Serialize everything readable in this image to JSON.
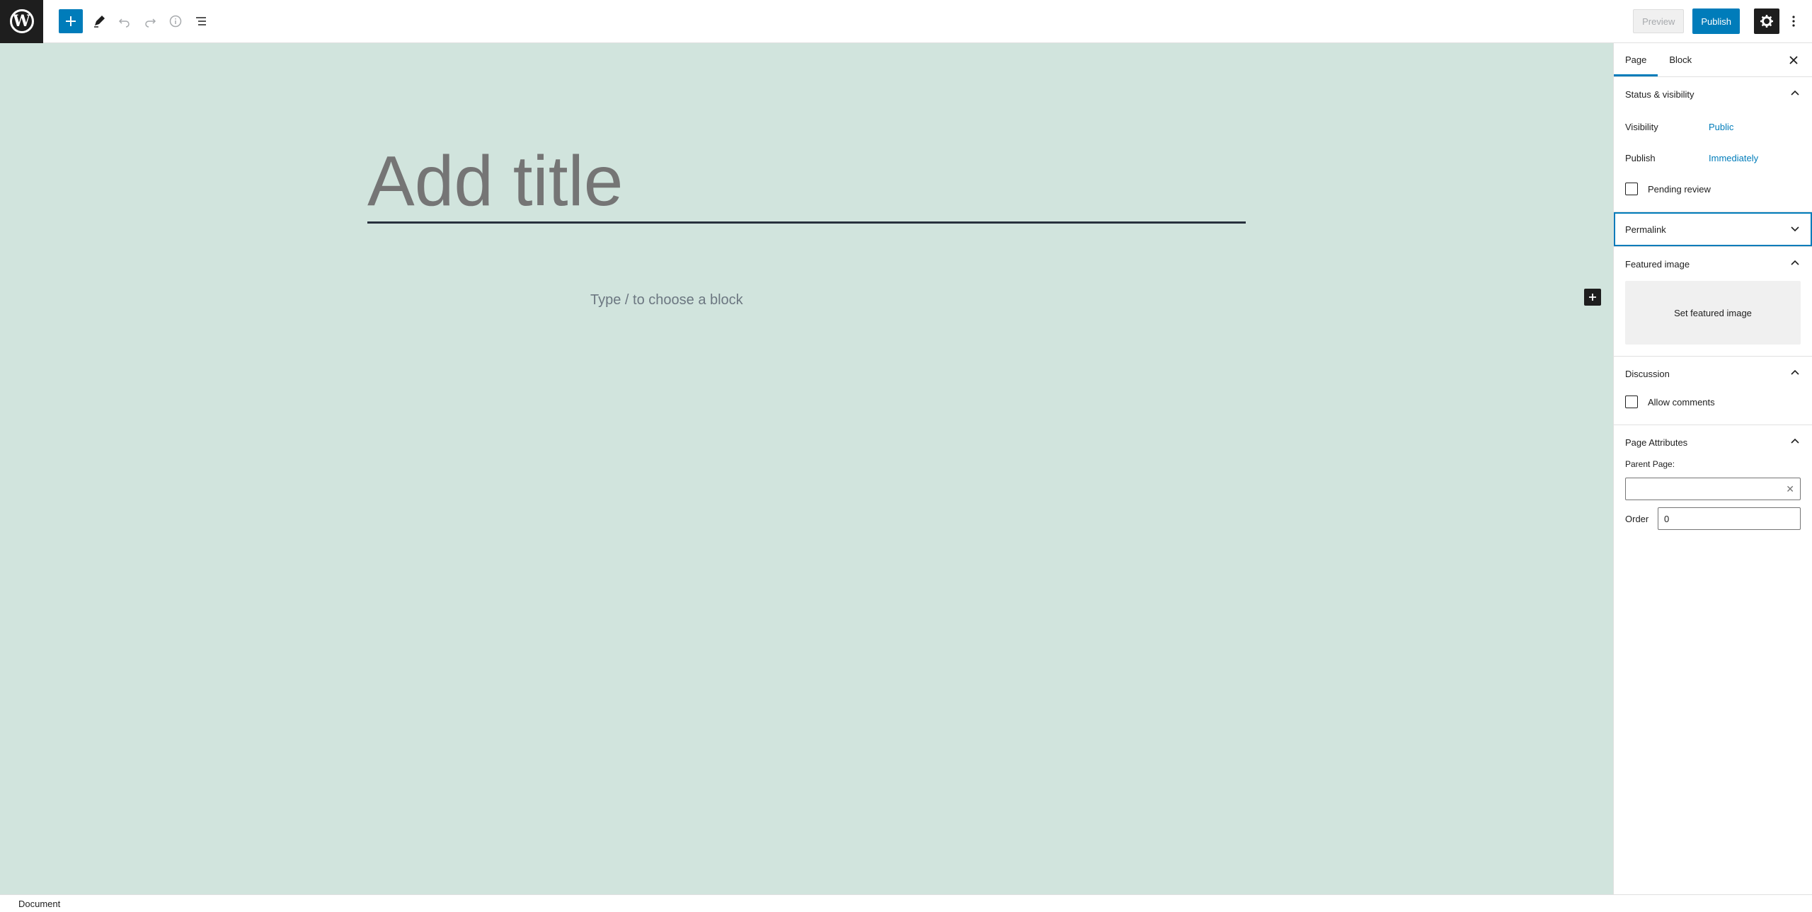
{
  "toolbar": {
    "logo_letter": "W",
    "preview_label": "Preview",
    "publish_label": "Publish",
    "accent_color": "#007cba"
  },
  "editor": {
    "title_placeholder": "Add title",
    "block_placeholder": "Type / to choose a block",
    "canvas_color": "#d1e4dd"
  },
  "sidebar": {
    "tabs": [
      {
        "label": "Page",
        "active": true
      },
      {
        "label": "Block",
        "active": false
      }
    ],
    "status": {
      "heading": "Status & visibility",
      "visibility_label": "Visibility",
      "visibility_value": "Public",
      "publish_label": "Publish",
      "publish_value": "Immediately",
      "pending_label": "Pending review"
    },
    "permalink": {
      "heading": "Permalink"
    },
    "featured": {
      "heading": "Featured image",
      "button_label": "Set featured image"
    },
    "discussion": {
      "heading": "Discussion",
      "allow_comments_label": "Allow comments"
    },
    "attributes": {
      "heading": "Page Attributes",
      "parent_label": "Parent Page:",
      "parent_value": "",
      "order_label": "Order",
      "order_value": "0"
    }
  },
  "footer": {
    "breadcrumb": "Document"
  }
}
